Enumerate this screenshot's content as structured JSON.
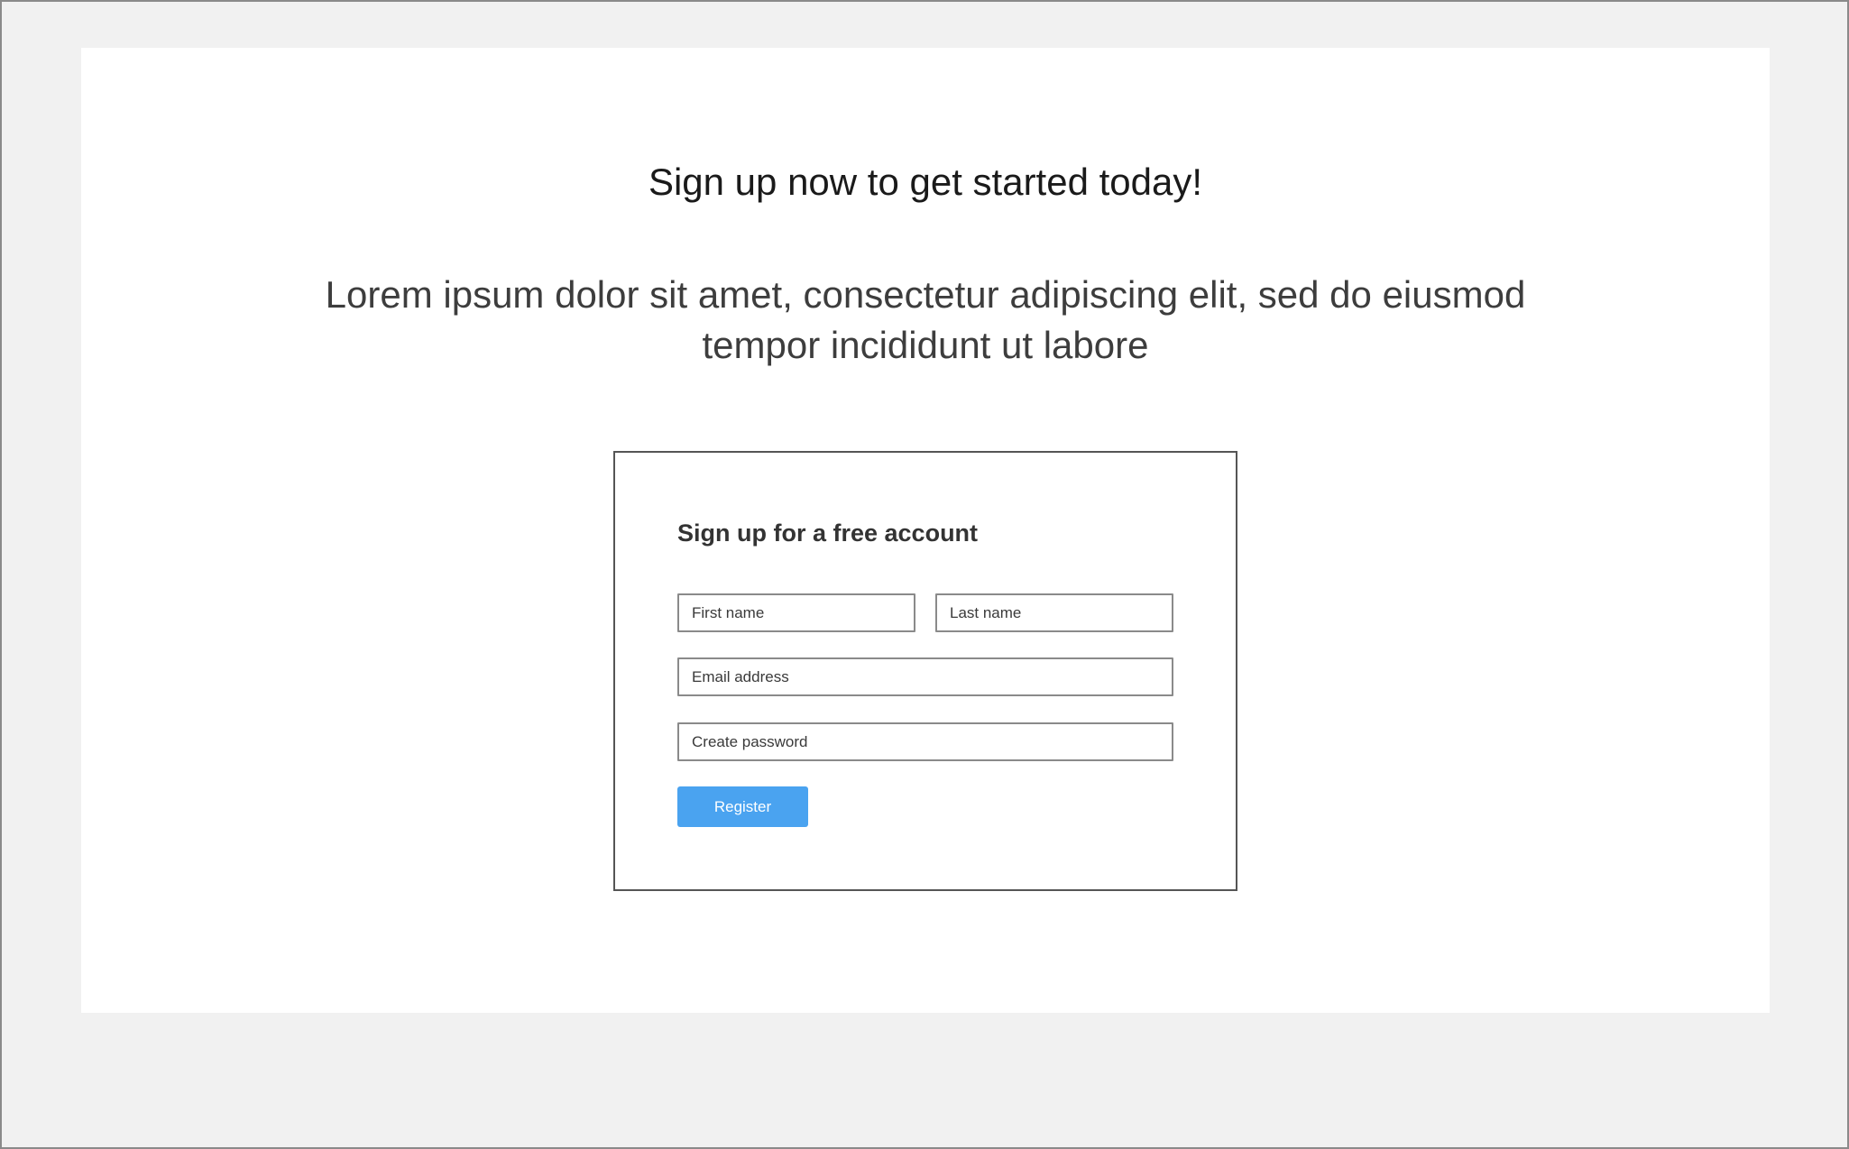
{
  "hero": {
    "title": "Sign up now to get started today!",
    "subtitle": "Lorem ipsum dolor sit amet, consectetur adipiscing elit, sed do eiusmod tempor incididunt ut labore"
  },
  "form": {
    "heading": "Sign up for a free account",
    "first_name_placeholder": "First name",
    "last_name_placeholder": "Last name",
    "email_placeholder": "Email address",
    "password_placeholder": "Create password",
    "register_label": "Register"
  },
  "colors": {
    "page_background": "#f1f1f1",
    "panel_background": "#ffffff",
    "accent": "#4aa3f0",
    "border": "#555555"
  }
}
